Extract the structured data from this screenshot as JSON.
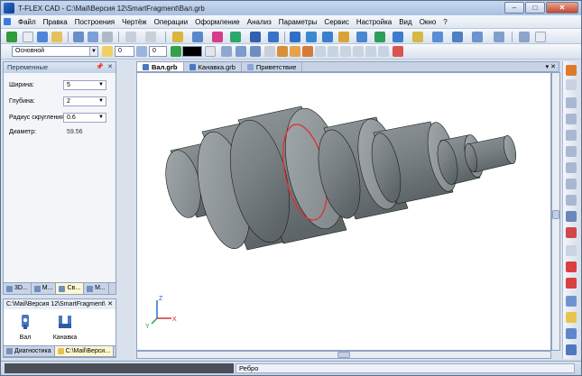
{
  "window": {
    "title": "T-FLEX CAD - C:\\Mail\\Версия 12\\SmartFragment\\Вал.grb"
  },
  "window_controls": {
    "minimize": "–",
    "maximize": "□",
    "close": "✕"
  },
  "menu": [
    "Файл",
    "Правка",
    "Построения",
    "Чертёж",
    "Операции",
    "Оформление",
    "Анализ",
    "Параметры",
    "Сервис",
    "Настройка",
    "Вид",
    "Окно",
    "?"
  ],
  "toolbar2": {
    "style_value": "Основной",
    "field1_value": "0",
    "field2_value": "0",
    "color_swatch": "#000000"
  },
  "variables_panel": {
    "title": "Переменные",
    "rows": [
      {
        "label": "Ширина:",
        "value": "5"
      },
      {
        "label": "Глубина:",
        "value": "2"
      },
      {
        "label": "Радиус скругления:",
        "value": "0.6"
      },
      {
        "label": "Диаметр:",
        "value": "59.56"
      }
    ],
    "tabs": [
      "3D...",
      "М...",
      "Св...",
      "М..."
    ]
  },
  "fragment_panel": {
    "path": "C:\\Mail\\Версия 12\\SmartFragment\\",
    "items": [
      {
        "label": "Вал",
        "icon": "shaft-icon"
      },
      {
        "label": "Канавка",
        "icon": "groove-icon"
      }
    ],
    "bottom_tabs": [
      "Диагностика",
      "C:\\Mail\\Верси..."
    ]
  },
  "doc_tabs": [
    "Вал.grb",
    "Канавка.grb",
    "Приветствие"
  ],
  "viewport": {
    "background": "#ffffff",
    "model_color": "#7e8689",
    "highlight_color": "#e03030",
    "axes": {
      "x": "X",
      "y": "Y",
      "z": "Z"
    }
  },
  "status_bar": {
    "text": "Ребро"
  }
}
